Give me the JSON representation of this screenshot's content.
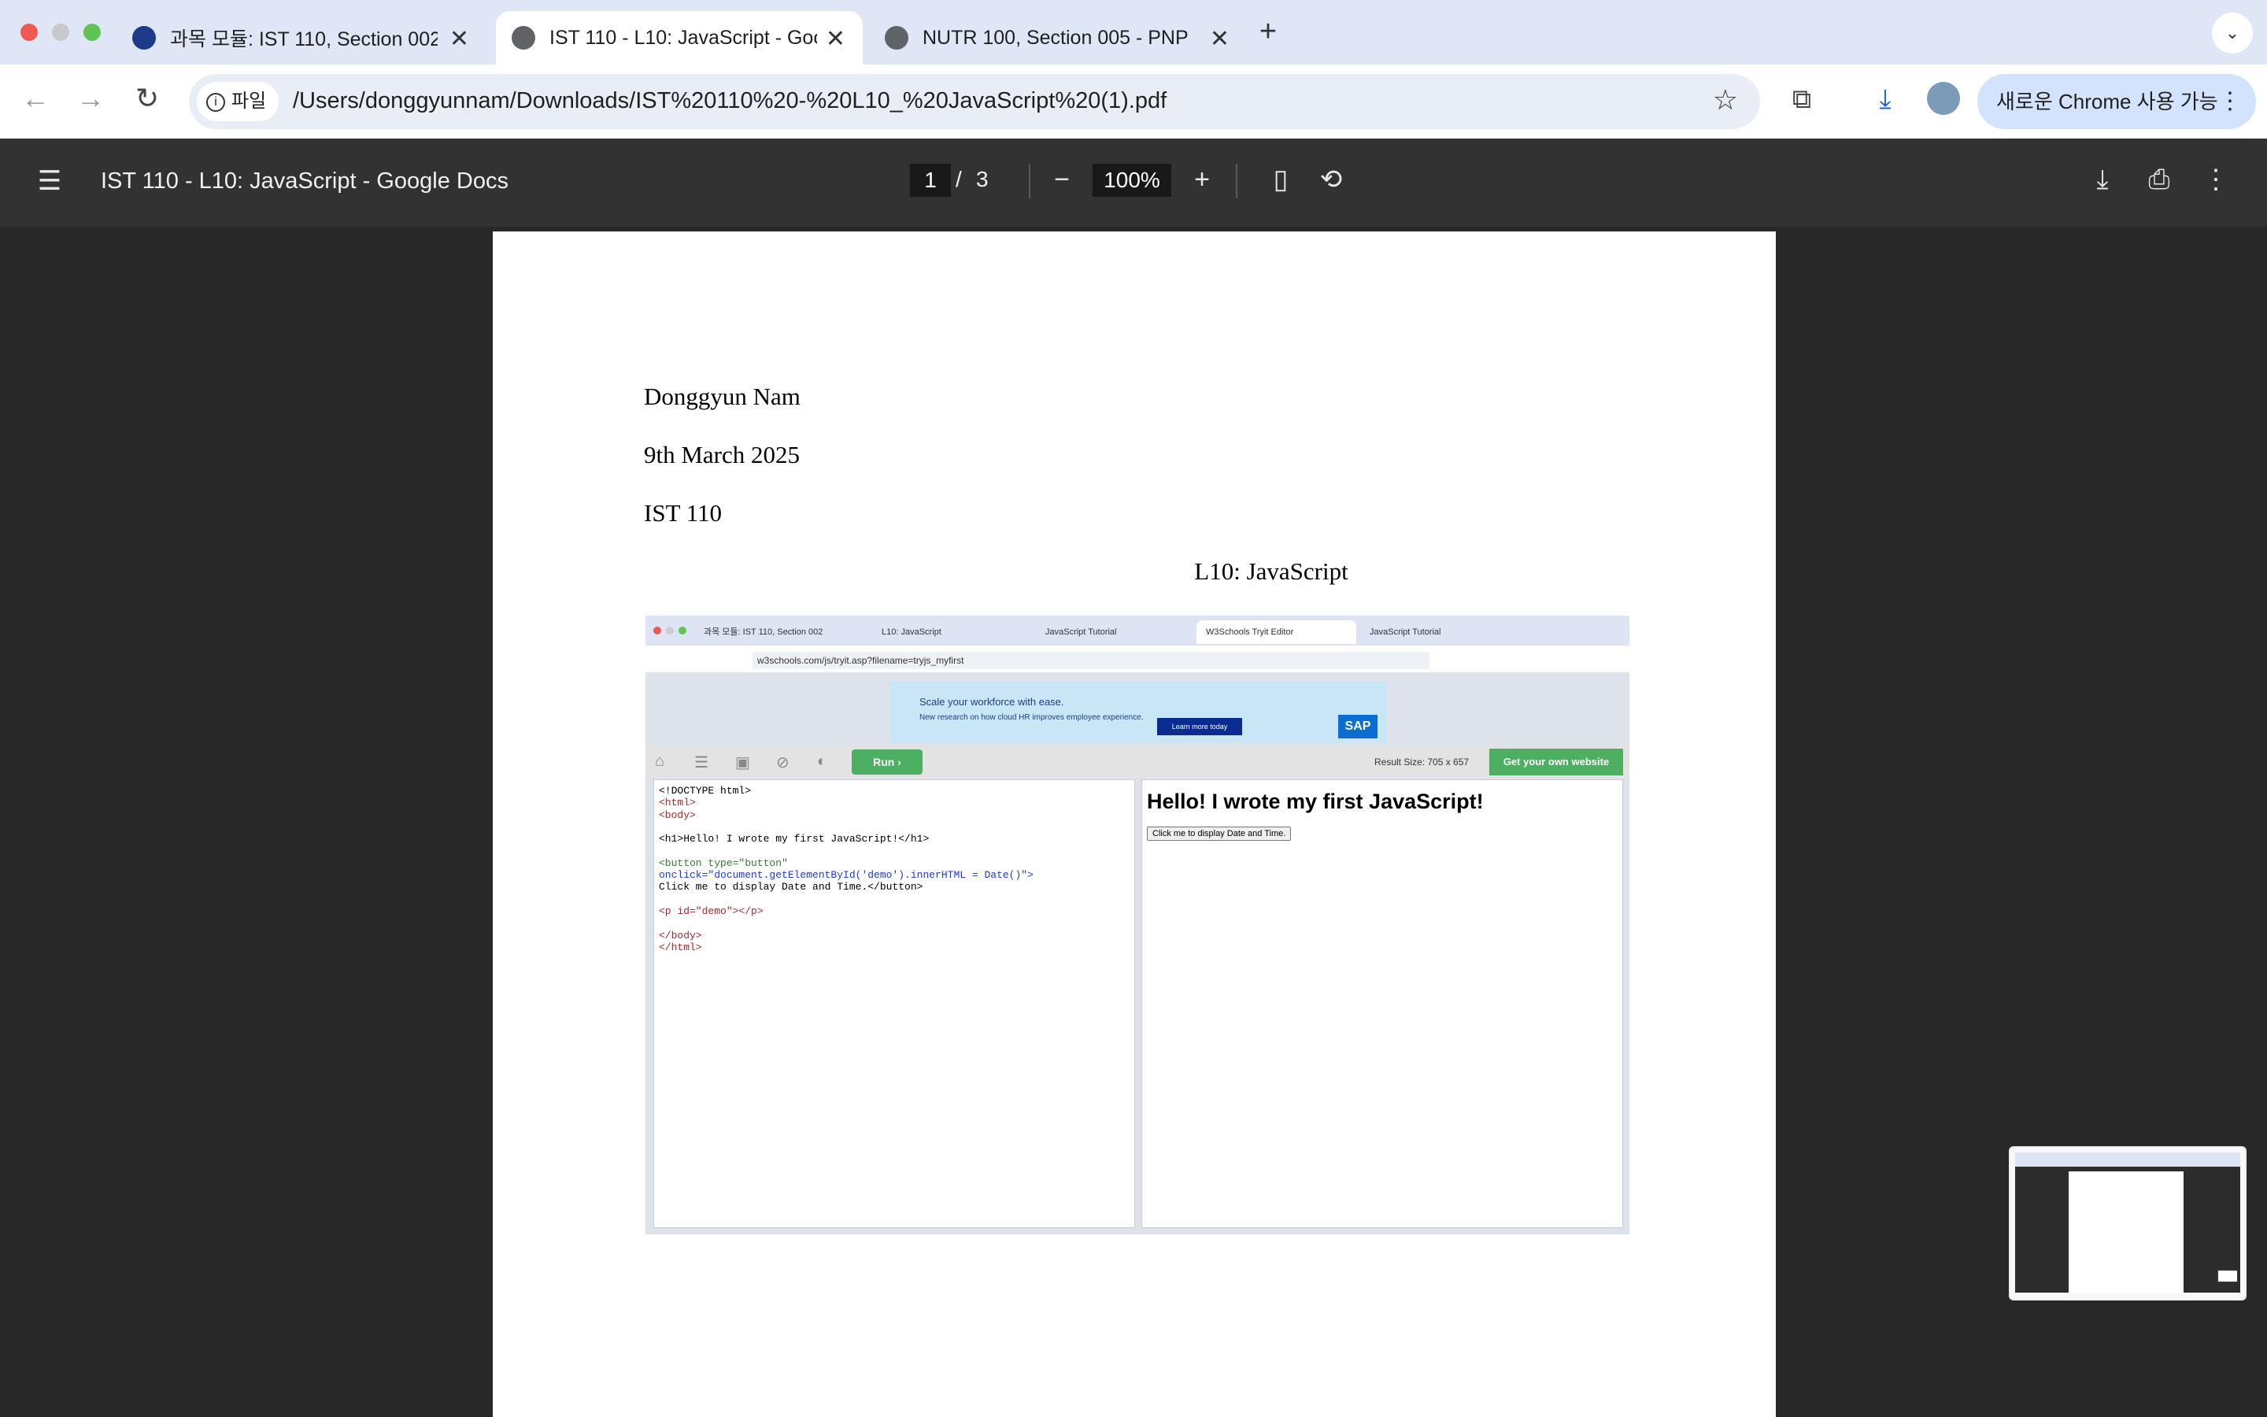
{
  "browser": {
    "tabs": [
      {
        "title": "과목 모듈: IST 110, Section 002"
      },
      {
        "title": "IST 110 - L10: JavaScript - Google Docs"
      },
      {
        "title": "NUTR 100, Section 005 - PNP"
      }
    ],
    "address": {
      "scheme_label": "파일",
      "url": "/Users/donggyunnam/Downloads/IST%20110%20-%20L10_%20JavaScript%20(1).pdf"
    },
    "update_button": "새로운 Chrome 사용 가능"
  },
  "pdf_viewer": {
    "title": "IST 110 - L10: JavaScript - Google Docs",
    "page_current": "1",
    "page_separator": "/",
    "page_total": "3",
    "zoom": "100%"
  },
  "document": {
    "lines": [
      "Donggyun Nam",
      "9th March 2025",
      "IST 110"
    ],
    "heading": "L10: JavaScript"
  },
  "screenshot": {
    "tabs": [
      "과목 모듈: IST 110, Section 002",
      "L10: JavaScript",
      "JavaScript Tutorial",
      "W3Schools Tryit Editor",
      "JavaScript Tutorial"
    ],
    "url": "w3schools.com/js/tryit.asp?filename=tryjs_myfirst",
    "ad_headline": "Scale your workforce with ease.",
    "ad_body": "New research on how cloud HR improves employee experience.",
    "ad_button": "Learn more today",
    "ad_brand": "SAP",
    "run_label": "Run",
    "result_size": "Result Size: 705 x 657",
    "get_site": "Get your own website",
    "code_lines": [
      "<!DOCTYPE html>",
      "<html>",
      "<body>",
      "",
      "<h1>Hello! I wrote my first JavaScript!</h1>",
      "",
      "<button type=\"button\"",
      "onclick=\"document.getElementById('demo').innerHTML = Date()\">",
      "Click me to display Date and Time.</button>",
      "",
      "<p id=\"demo\"></p>",
      "",
      "</body>",
      "</html>"
    ],
    "result_heading": "Hello! I wrote my first JavaScript!",
    "result_button": "Click me to display Date and Time."
  }
}
